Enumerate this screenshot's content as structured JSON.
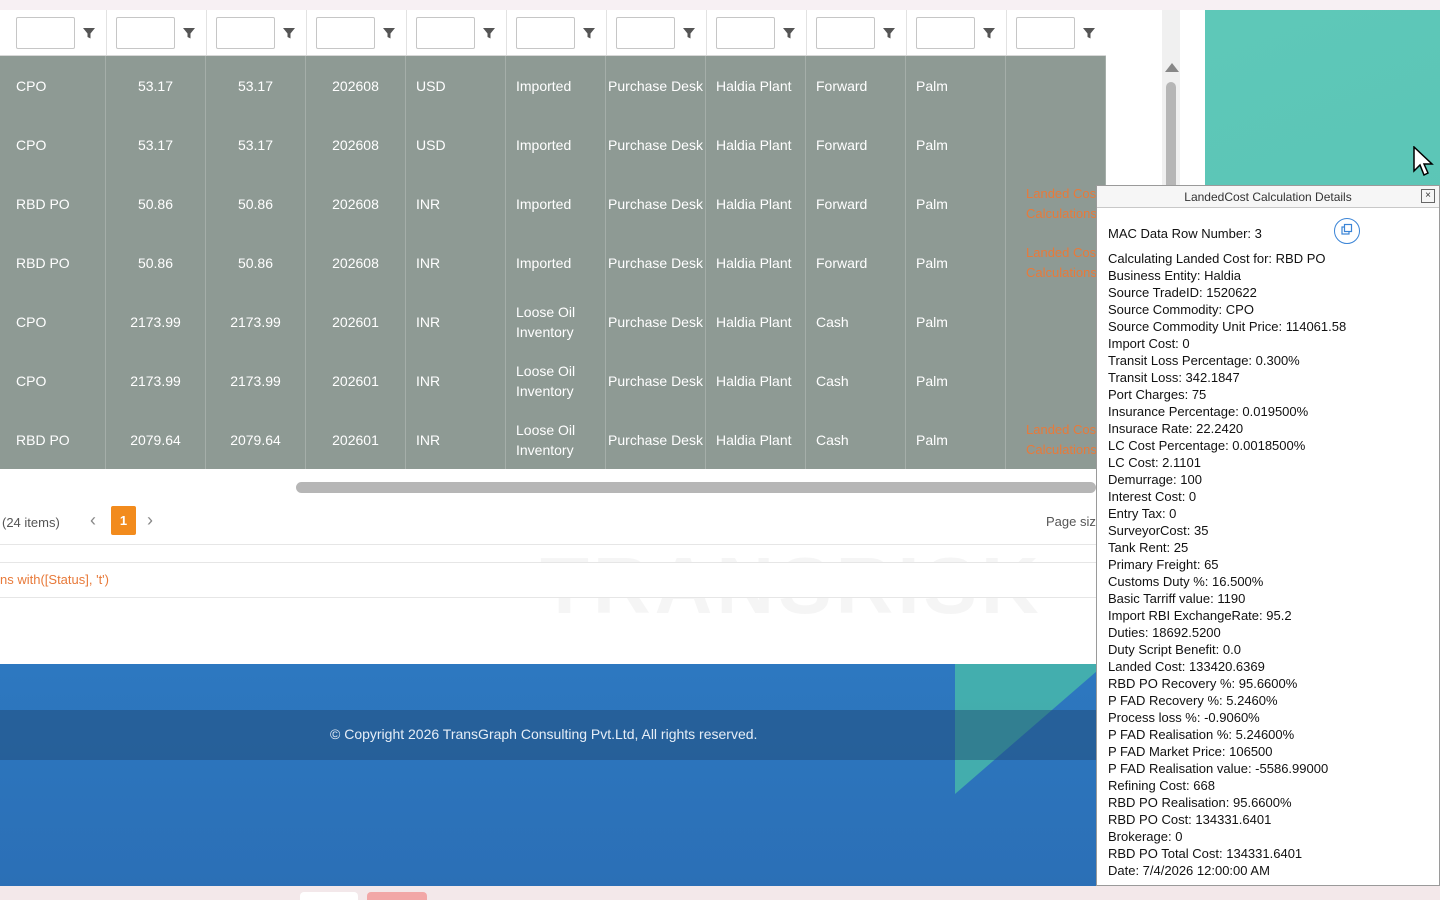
{
  "columns": [
    {
      "align": "l"
    },
    {
      "align": "c"
    },
    {
      "align": "c"
    },
    {
      "align": "c"
    },
    {
      "align": "l"
    },
    {
      "align": "l"
    },
    {
      "align": "c"
    },
    {
      "align": "l"
    },
    {
      "align": "l"
    },
    {
      "align": "l"
    },
    {
      "align": "l"
    }
  ],
  "rows": [
    [
      "CPO",
      "53.17",
      "53.17",
      "202608",
      "USD",
      "Imported",
      "Purchase Desk",
      "Haldia Plant",
      "Forward",
      "Palm",
      ""
    ],
    [
      "CPO",
      "53.17",
      "53.17",
      "202608",
      "USD",
      "Imported",
      "Purchase Desk",
      "Haldia Plant",
      "Forward",
      "Palm",
      ""
    ],
    [
      "RBD PO",
      "50.86",
      "50.86",
      "202608",
      "INR",
      "Imported",
      "Purchase Desk",
      "Haldia Plant",
      "Forward",
      "Palm",
      "Landed Cost Calculations"
    ],
    [
      "RBD PO",
      "50.86",
      "50.86",
      "202608",
      "INR",
      "Imported",
      "Purchase Desk",
      "Haldia Plant",
      "Forward",
      "Palm",
      "Landed Cost Calculations"
    ],
    [
      "CPO",
      "2173.99",
      "2173.99",
      "202601",
      "INR",
      "Loose Oil Inventory",
      "Purchase Desk",
      "Haldia Plant",
      "Cash",
      "Palm",
      ""
    ],
    [
      "CPO",
      "2173.99",
      "2173.99",
      "202601",
      "INR",
      "Loose Oil Inventory",
      "Purchase Desk",
      "Haldia Plant",
      "Cash",
      "Palm",
      ""
    ],
    [
      "RBD PO",
      "2079.64",
      "2079.64",
      "202601",
      "INR",
      "Loose Oil Inventory",
      "Purchase Desk",
      "Haldia Plant",
      "Cash",
      "Palm",
      "Landed Cost Calculations"
    ]
  ],
  "pager": {
    "items_count": "(24 items)",
    "prev": "‹",
    "current_page": "1",
    "next": "›",
    "page_size_label": "Page siz"
  },
  "filter_expression": "ns with([Status], 't')",
  "watermark": "TRANSRISK",
  "footer": {
    "copyright": "© Copyright 2026 TransGraph Consulting Pvt.Ltd, All rights reserved."
  },
  "popup": {
    "title": "LandedCost Calculation Details",
    "close": "×",
    "row_number": "MAC Data Row Number: 3",
    "lines": [
      "Calculating Landed Cost for: RBD PO",
      "Business Entity: Haldia",
      "Source TradeID: 1520622",
      "Source Commodity: CPO",
      "Source Commodity Unit Price: 114061.58",
      "Import Cost: 0",
      "Transit Loss Percentage: 0.300%",
      "Transit Loss: 342.1847",
      "Port Charges: 75",
      "Insurance Percentage: 0.019500%",
      "Insurace Rate: 22.2420",
      "LC Cost Percentage: 0.0018500%",
      "LC Cost: 2.1101",
      "Demurrage: 100",
      "Interest Cost: 0",
      "Entry Tax: 0",
      "SurveyorCost: 35",
      "Tank Rent: 25",
      "Primary Freight: 65",
      "Customs Duty %: 16.500%",
      "Basic Tarriff value: 1190",
      "Import RBI ExchangeRate: 95.2",
      "Duties: 18692.5200",
      "Duty Script Benefit: 0.0",
      "Landed Cost: 133420.6369",
      "RBD PO Recovery %: 95.6600%",
      "P FAD Recovery %: 5.2460%",
      "Process loss %: -0.9060%",
      "P FAD Realisation %: 5.24600%",
      "P FAD Market Price: 106500",
      "P FAD Realisation value: -5586.99000",
      "Refining Cost: 668",
      "RBD PO Realisation: 95.6600%",
      "RBD PO Cost: 134331.6401",
      "Brokerage: 0",
      "RBD PO Total Cost: 134331.6401",
      "Date: 7/4/2026 12:00:00 AM"
    ]
  },
  "colors": {
    "row_bg": "#8e9a94",
    "accent": "#f28b1d",
    "link": "#e87a3a"
  },
  "icons": {
    "filter": "filter-icon",
    "copy": "copy-icon",
    "close": "close-icon",
    "cursor": "mouse-cursor-icon"
  }
}
